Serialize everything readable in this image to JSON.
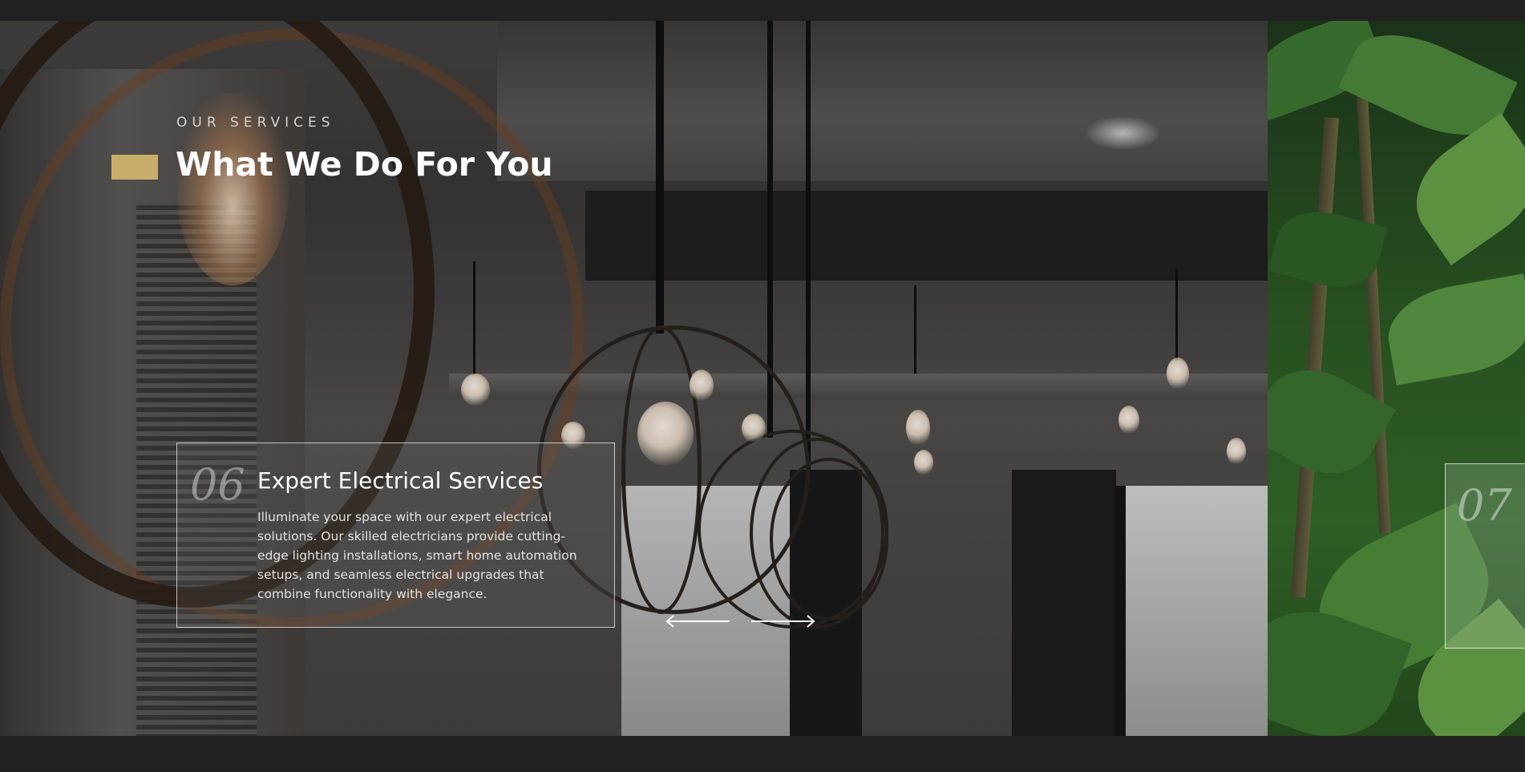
{
  "section": {
    "eyebrow": "OUR SERVICES",
    "title": "What We Do For You",
    "accent_color": "#c8ad6b"
  },
  "slides": [
    {
      "number": "06",
      "title": "Expert Electrical Services",
      "description": "Illuminate your space with our expert electrical solutions. Our skilled electricians provide cutting-edge lighting installations, smart home automation setups, and seamless electrical upgrades that combine functionality with elegance.",
      "background": "pendant-lamps-interior"
    },
    {
      "number": "07",
      "background": "jungle-garden"
    }
  ],
  "navigation": {
    "prev_icon": "arrow-left-icon",
    "next_icon": "arrow-right-icon"
  }
}
